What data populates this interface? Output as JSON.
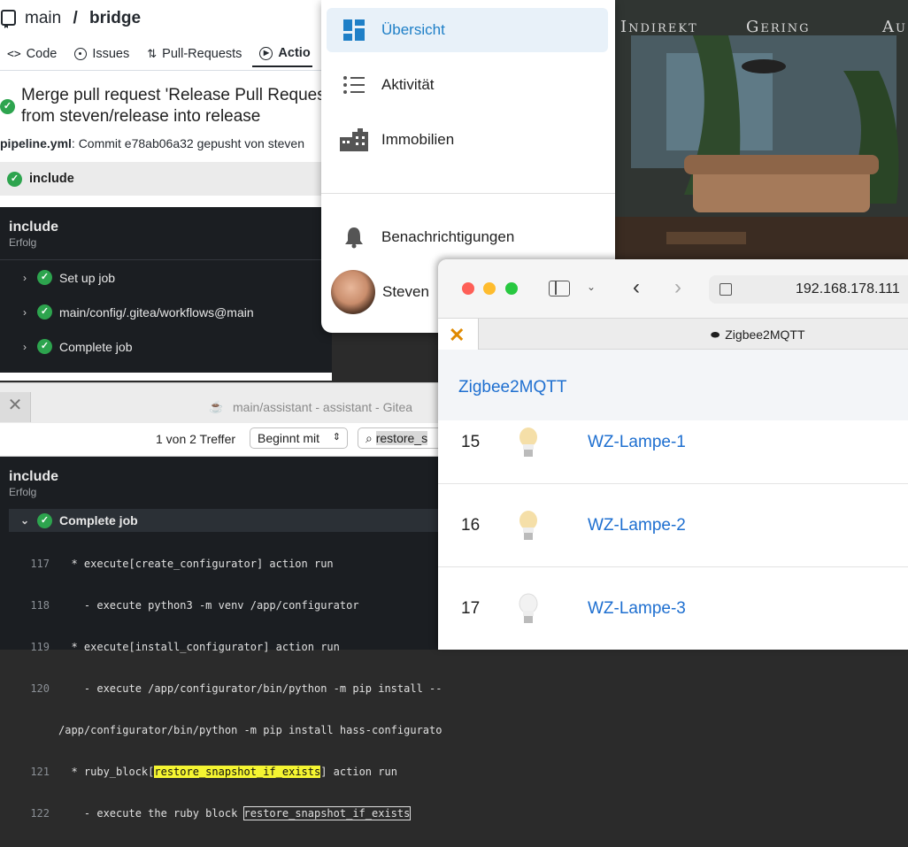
{
  "gitea": {
    "repo_owner": "main",
    "repo_sep": " / ",
    "repo_name": "bridge",
    "tabs": [
      {
        "label": "Code"
      },
      {
        "label": "Issues"
      },
      {
        "label": "Pull-Requests"
      },
      {
        "label": "Actio"
      }
    ],
    "run_title": "Merge pull request 'Release Pull Request' from steven/release into release",
    "commit_file": "pipeline.yml",
    "commit_text": ": Commit e78ab06a32 gepusht von steven",
    "job_name": "include",
    "log": {
      "title": "include",
      "status": "Erfolg",
      "steps": [
        {
          "label": "Set up job"
        },
        {
          "label": "main/config/.gitea/workflows@main"
        },
        {
          "label": "Complete job"
        }
      ]
    }
  },
  "gitea2": {
    "window_title": "main/assistant - assistant - Gitea",
    "find": {
      "count": "1 von 2 Treffer",
      "mode": "Beginnt mit",
      "query": "restore_s"
    },
    "log": {
      "title": "include",
      "status": "Erfolg",
      "step": "Complete job"
    },
    "lines": [
      {
        "n": "117",
        "text": "  * execute[create_configurator] action run"
      },
      {
        "n": "118",
        "text": "    - execute python3 -m venv /app/configurator"
      },
      {
        "n": "119",
        "text": "  * execute[install_configurator] action run"
      },
      {
        "n": "120",
        "text": "    - execute /app/configurator/bin/python -m pip install --"
      },
      {
        "n": "",
        "text": "/app/configurator/bin/python -m pip install hass-configurato"
      },
      {
        "n": "121",
        "pre": "  * ruby_block[",
        "hl": "restore_snapshot_if_exists",
        "post": "] action run"
      },
      {
        "n": "122",
        "pre": "    - execute the ruby block ",
        "hlo": "restore_snapshot_if_exists",
        "post": ""
      }
    ]
  },
  "menu": {
    "items": [
      {
        "label": "Übersicht",
        "icon": "dashboard-icon"
      },
      {
        "label": "Aktivität",
        "icon": "list-icon"
      },
      {
        "label": "Immobilien",
        "icon": "buildings-icon"
      },
      {
        "label": "Benachrichtigungen",
        "icon": "bell-icon"
      },
      {
        "label": "Steven",
        "icon": "avatar"
      }
    ]
  },
  "photo": {
    "nav": [
      "Indirekt",
      "Gering",
      "Au"
    ]
  },
  "safari": {
    "url": "192.168.178.111",
    "tab_title": "Zigbee2MQTT",
    "header": "Zigbee2MQTT",
    "devices": [
      {
        "id": "15",
        "name": "WZ-Lampe-1"
      },
      {
        "id": "16",
        "name": "WZ-Lampe-2"
      },
      {
        "id": "17",
        "name": "WZ-Lampe-3"
      }
    ]
  },
  "colors": {
    "accent": "#1e7fc7",
    "success": "#2da44e",
    "link": "#1e6fd0"
  }
}
